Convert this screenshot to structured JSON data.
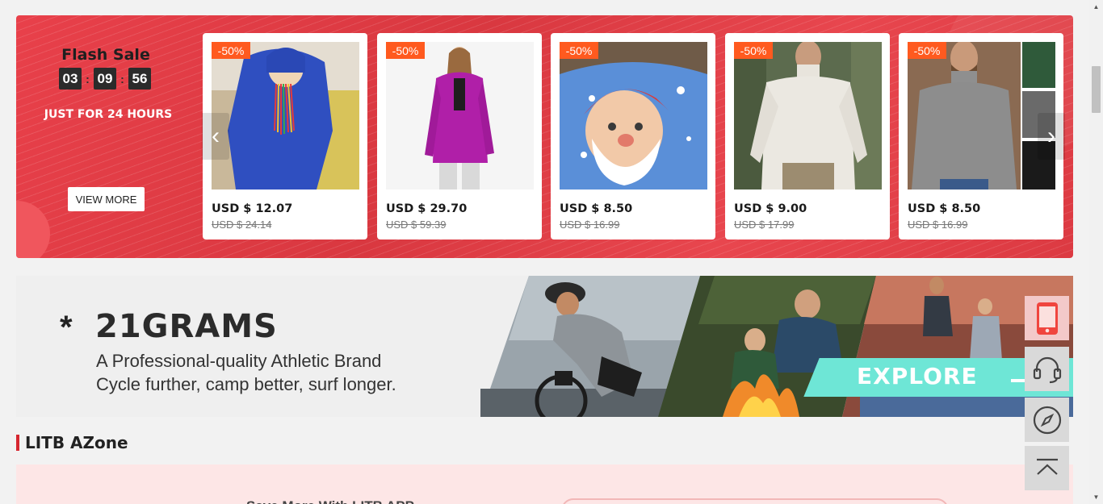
{
  "flash_sale": {
    "title": "Flash Sale",
    "countdown": {
      "hours": "03",
      "minutes": "09",
      "seconds": "56"
    },
    "subtitle": "JUST FOR 24 HOURS",
    "view_more": "VIEW MORE",
    "products": [
      {
        "discount": "-50%",
        "price": "USD $ 12.07",
        "original_price": "USD $ 24.14",
        "image": "blue-hoodie-set"
      },
      {
        "discount": "-50%",
        "price": "USD $ 29.70",
        "original_price": "USD $ 59.39",
        "image": "magenta-jacket"
      },
      {
        "discount": "-50%",
        "price": "USD $ 8.50",
        "original_price": "USD $ 16.99",
        "image": "santa-sweatshirt"
      },
      {
        "discount": "-50%",
        "price": "USD $ 9.00",
        "original_price": "USD $ 17.99",
        "image": "white-turtleneck"
      },
      {
        "discount": "-50%",
        "price": "USD $ 8.50",
        "original_price": "USD $ 16.99",
        "image": "grey-turtleneck"
      }
    ]
  },
  "brand_banner": {
    "star": "*",
    "title": "21GRAMS",
    "line1": "A Professional-quality Athletic Brand",
    "line2": "Cycle further, camp better, surf longer.",
    "cta": "EXPLORE"
  },
  "azone": {
    "title": "LITB AZone",
    "partial_text": "Save More With LITB APP"
  },
  "side_toolbar": [
    "mobile-app-icon",
    "customer-support-icon",
    "compass-icon",
    "back-to-top-icon"
  ],
  "colors": {
    "flash_red": "#e2404a",
    "badge_orange": "#ff5a1f",
    "explore_teal": "#6ee6d6",
    "accent_red": "#d6262f"
  }
}
